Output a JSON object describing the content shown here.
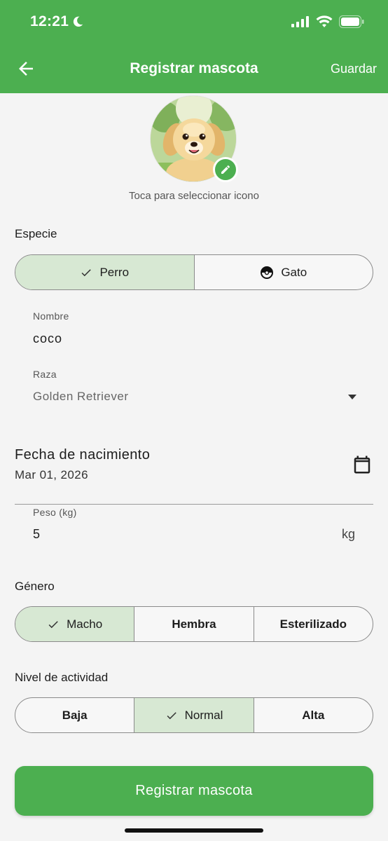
{
  "status_bar": {
    "time": "12:21"
  },
  "header": {
    "title": "Registrar mascota",
    "save_label": "Guardar"
  },
  "avatar": {
    "hint": "Toca para seleccionar icono"
  },
  "species": {
    "label": "Especie",
    "options": [
      {
        "label": "Perro",
        "selected": true
      },
      {
        "label": "Gato",
        "selected": false
      }
    ]
  },
  "name_field": {
    "label": "Nombre",
    "value": "coco"
  },
  "breed_field": {
    "label": "Raza",
    "value": "Golden Retriever"
  },
  "birth_date": {
    "label": "Fecha de nacimiento",
    "value": "Mar 01, 2026"
  },
  "weight_field": {
    "label": "Peso (kg)",
    "value": "5",
    "unit": "kg"
  },
  "gender": {
    "label": "Género",
    "options": [
      {
        "label": "Macho",
        "selected": true
      },
      {
        "label": "Hembra",
        "selected": false
      },
      {
        "label": "Esterilizado",
        "selected": false
      }
    ]
  },
  "activity": {
    "label": "Nivel de actividad",
    "options": [
      {
        "label": "Baja",
        "selected": false
      },
      {
        "label": "Normal",
        "selected": true
      },
      {
        "label": "Alta",
        "selected": false
      }
    ]
  },
  "submit": {
    "label": "Registrar mascota"
  },
  "colors": {
    "primary": "#4caf50",
    "selected_segment": "#d7e8d3",
    "background": "#f4f4f4"
  }
}
